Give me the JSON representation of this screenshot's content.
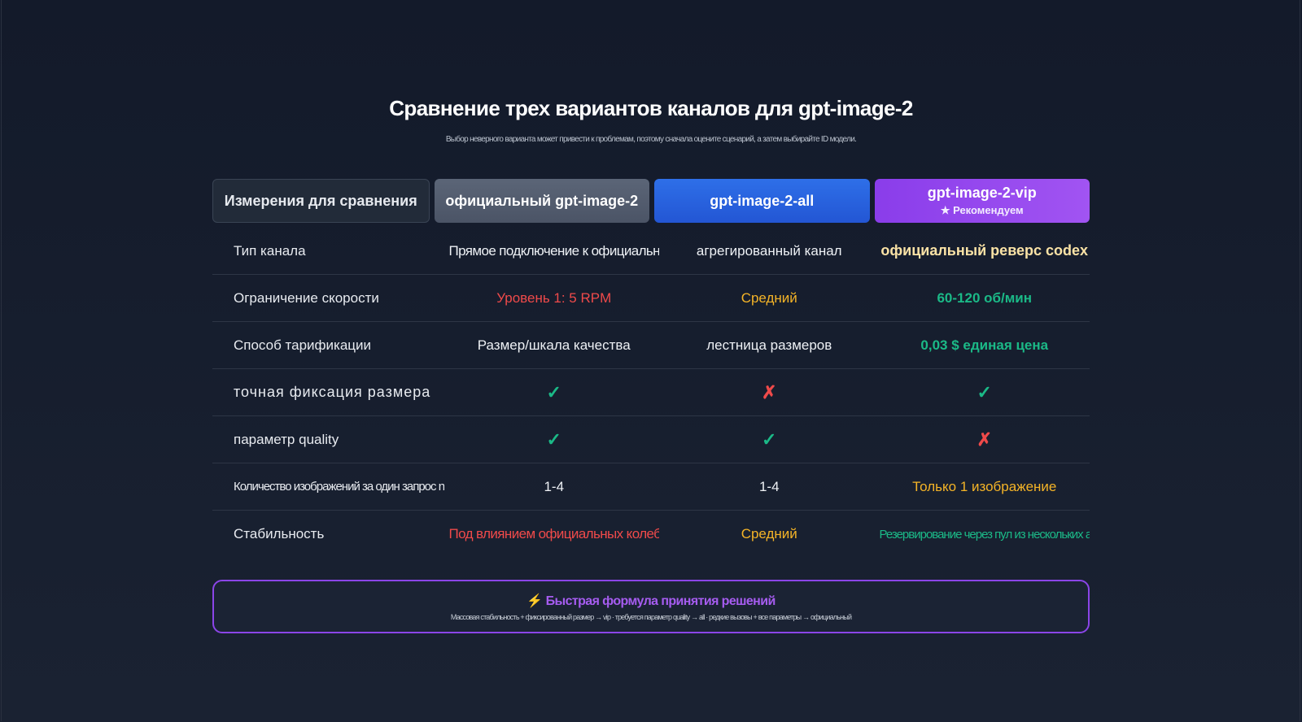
{
  "title": "Сравнение трех вариантов каналов для gpt-image-2",
  "subtitle": "Выбор неверного варианта может привести к проблемам, поэтому сначала оцените сценарий, а затем выбирайте ID модели.",
  "header": {
    "dimension": "Измерения для сравнения",
    "official": "официальный gpt-image-2",
    "all": "gpt-image-2-all",
    "vip": "gpt-image-2-vip",
    "vip_badge": "★ Рекомендуем"
  },
  "rows": [
    {
      "label": "Тип канала",
      "official": "Прямое подключение к официальному API",
      "all": "агрегированный канал",
      "vip": "официальный реверс codex"
    },
    {
      "label": "Ограничение скорости",
      "official": "Уровень 1: 5 RPM",
      "all": "Средний",
      "vip": "60-120 об/мин"
    },
    {
      "label": "Способ тарификации",
      "official": "Размер/шкала качества",
      "all": "лестница размеров",
      "vip": "0,03 $ единая цена"
    },
    {
      "label": "точная фиксация размера",
      "official": "✓",
      "all": "✗",
      "vip": "✓"
    },
    {
      "label": "параметр quality",
      "official": "✓",
      "all": "✓",
      "vip": "✗"
    },
    {
      "label": "Количество изображений за один запрос n",
      "official": "1-4",
      "all": "1-4",
      "vip": "Только 1 изображение"
    },
    {
      "label": "Стабильность",
      "official": "Под влиянием официальных колебаний",
      "all": "Средний",
      "vip": "Резервирование через пул из нескольких аккаунтов"
    }
  ],
  "formula": {
    "icon": "⚡",
    "title": "Быстрая формула принятия решений",
    "text": "Массовая стабильность + фиксированный размер → vip · требуется параметр quality → all · редкие вызовы + все параметры → официальный"
  },
  "colors": {
    "background": "#131a2a",
    "official_header": "#5b6577",
    "all_header": "#2e6fe8",
    "vip_header": "#a154f2",
    "ok": "#1bb987",
    "bad": "#ef4a4a",
    "warn": "#f5b427",
    "highlight": "#fbe3a6"
  }
}
